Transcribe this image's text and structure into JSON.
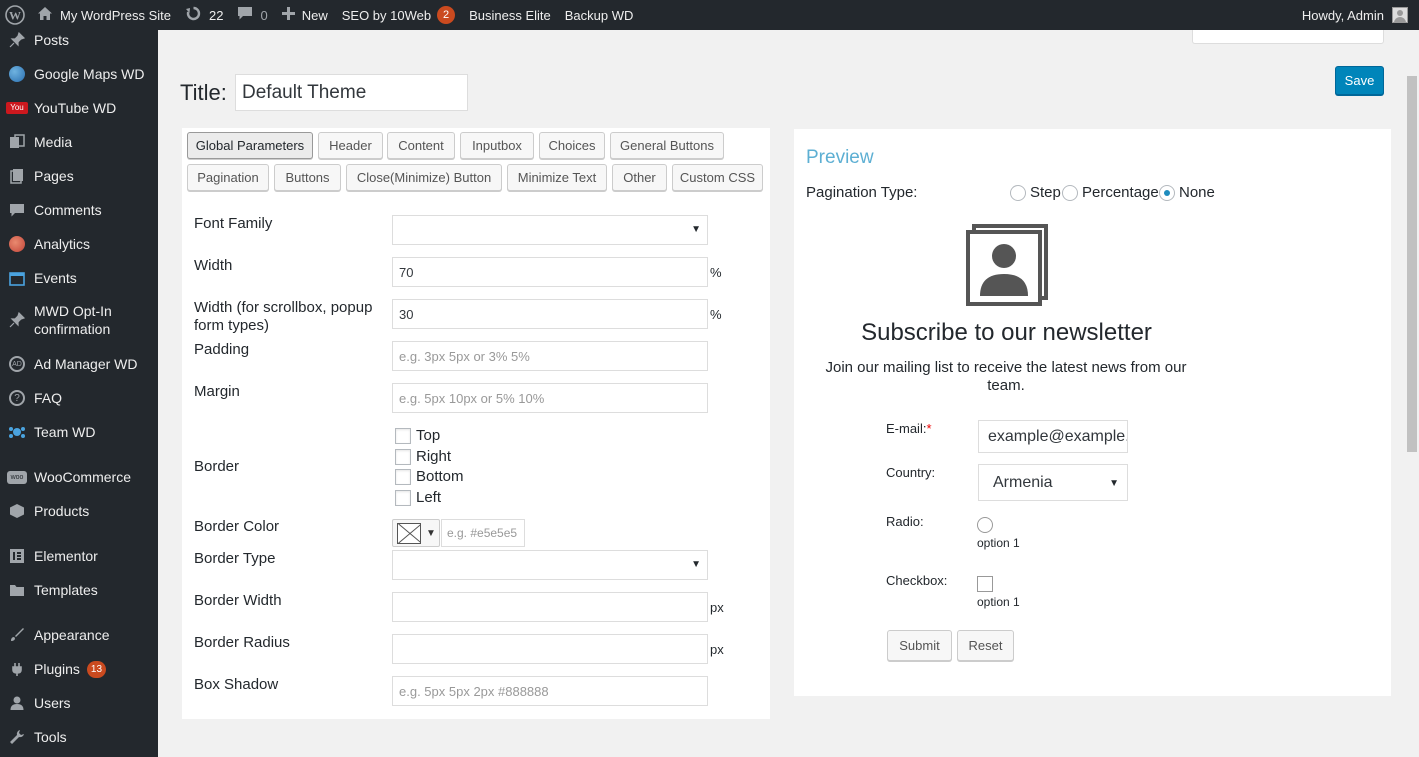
{
  "adminbar": {
    "site_name": "My WordPress Site",
    "updates_count": "22",
    "comments_count": "0",
    "new_label": "New",
    "seo_label": "SEO by 10Web",
    "seo_badge": "2",
    "business_label": "Business Elite",
    "backup_label": "Backup WD",
    "howdy": "Howdy, Admin"
  },
  "sidebar": {
    "items": [
      {
        "label": "Posts",
        "icon": "pin-icon"
      },
      {
        "label": "Google Maps WD",
        "icon": "globe-icon"
      },
      {
        "label": "YouTube WD",
        "icon": "youtube-icon"
      },
      {
        "label": "Media",
        "icon": "media-icon"
      },
      {
        "label": "Pages",
        "icon": "pages-icon"
      },
      {
        "label": "Comments",
        "icon": "comment-icon"
      },
      {
        "label": "Analytics",
        "icon": "analytics-icon"
      },
      {
        "label": "Events",
        "icon": "calendar-icon"
      },
      {
        "label": "MWD Opt-In confirmation",
        "icon": "pin-icon"
      },
      {
        "label": "Ad Manager WD",
        "icon": "ad-icon"
      },
      {
        "label": "FAQ",
        "icon": "question-icon"
      },
      {
        "label": "Team WD",
        "icon": "team-icon"
      },
      {
        "label": "WooCommerce",
        "icon": "woo-icon"
      },
      {
        "label": "Products",
        "icon": "box-icon"
      },
      {
        "label": "Elementor",
        "icon": "elementor-icon"
      },
      {
        "label": "Templates",
        "icon": "folder-icon"
      },
      {
        "label": "Appearance",
        "icon": "brush-icon"
      },
      {
        "label": "Plugins",
        "icon": "plug-icon",
        "badge": "13"
      },
      {
        "label": "Users",
        "icon": "user-icon"
      },
      {
        "label": "Tools",
        "icon": "wrench-icon"
      }
    ]
  },
  "main": {
    "title_label": "Title:",
    "title_value": "Default Theme",
    "save_label": "Save"
  },
  "tabs": [
    "Global Parameters",
    "Header",
    "Content",
    "Inputbox",
    "Choices",
    "General Buttons",
    "Pagination",
    "Buttons",
    "Close(Minimize) Button",
    "Minimize Text",
    "Other",
    "Custom CSS"
  ],
  "settings": {
    "font_family": {
      "label": "Font Family",
      "value": ""
    },
    "width": {
      "label": "Width",
      "value": "70",
      "unit": "%"
    },
    "width_scroll": {
      "label": "Width (for scrollbox, popup form types)",
      "value": "30",
      "unit": "%"
    },
    "padding": {
      "label": "Padding",
      "placeholder": "e.g. 3px 5px or 3% 5%"
    },
    "margin": {
      "label": "Margin",
      "placeholder": "e.g. 5px 10px or 5% 10%"
    },
    "border": {
      "label": "Border",
      "options": [
        "Top",
        "Right",
        "Bottom",
        "Left"
      ]
    },
    "border_color": {
      "label": "Border Color",
      "placeholder": "e.g. #e5e5e5"
    },
    "border_type": {
      "label": "Border Type",
      "value": ""
    },
    "border_width": {
      "label": "Border Width",
      "unit": "px"
    },
    "border_radius": {
      "label": "Border Radius",
      "unit": "px"
    },
    "box_shadow": {
      "label": "Box Shadow",
      "placeholder": "e.g. 5px 5px 2px #888888"
    }
  },
  "preview": {
    "title": "Preview",
    "pagination_label": "Pagination Type:",
    "pagination_options": [
      "Step",
      "Percentage",
      "None"
    ],
    "pagination_selected": "None",
    "nl_title": "Subscribe to our newsletter",
    "nl_desc": "Join our mailing list to receive the latest news from our team.",
    "email_label": "E-mail:",
    "email_required": "*",
    "email_value": "example@example.com",
    "country_label": "Country:",
    "country_value": "Armenia",
    "radio_label": "Radio:",
    "radio_option": "option 1",
    "checkbox_label": "Checkbox:",
    "checkbox_option": "option 1",
    "submit_label": "Submit",
    "reset_label": "Reset"
  },
  "colors": {
    "adminbar_bg": "#23282d",
    "primary_button": "#0085ba",
    "preview_title": "#5dafd3",
    "badge": "#ca4a1f"
  }
}
